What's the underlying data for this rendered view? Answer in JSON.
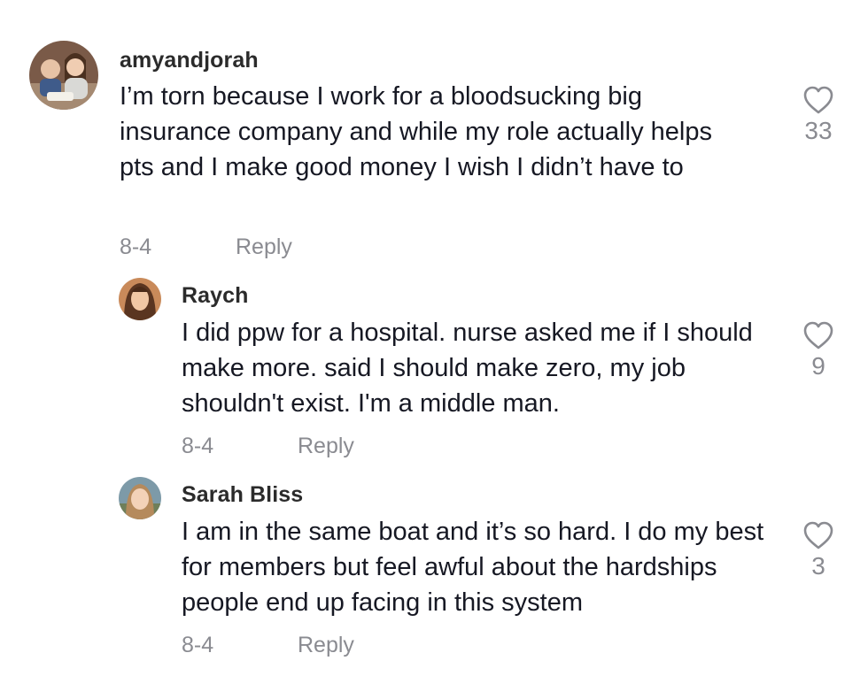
{
  "comments": [
    {
      "username": "amyandjorah",
      "text": "I’m torn because I work for a bloodsucking big insurance company and while my role actually helps pts and I make good money I wish I didn’t have to",
      "date": "8-4",
      "reply_label": "Reply",
      "likes": "33"
    },
    {
      "username": "Raych",
      "text": "I did ppw for a hospital. nurse asked me if I should make more. said I should make zero, my job shouldn't exist. I'm a middle man.",
      "date": "8-4",
      "reply_label": "Reply",
      "likes": "9"
    },
    {
      "username": "Sarah Bliss",
      "text": "I am in the same boat and it’s so hard. I do my best for members but feel awful about the hardships people end up facing in this system",
      "date": "8-4",
      "reply_label": "Reply",
      "likes": "3"
    }
  ],
  "icons": {
    "like": "heart-outline-icon",
    "avatar": "user-avatar"
  },
  "colors": {
    "text": "#161823",
    "muted": "#8a8b91",
    "username": "#2b2b2b",
    "background": "#ffffff"
  }
}
